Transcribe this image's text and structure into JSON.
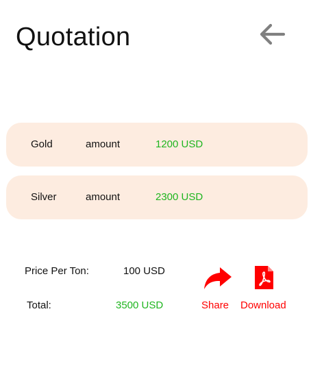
{
  "header": {
    "title": "Quotation",
    "back_icon": "arrow-left-icon"
  },
  "items": [
    {
      "metal": "Gold",
      "amount_label": "amount",
      "value": "1200 USD"
    },
    {
      "metal": "Silver",
      "amount_label": "amount",
      "value": "2300 USD"
    }
  ],
  "summary": {
    "price_label": "Price Per Ton:",
    "price_value": "100 USD",
    "total_label": "Total:",
    "total_value": "3500 USD"
  },
  "actions": {
    "share_label": "Share",
    "share_icon": "share-icon",
    "download_label": "Download",
    "download_icon": "pdf-icon"
  },
  "colors": {
    "card_background": "#fdece0",
    "value_green": "#1fb51f",
    "action_red": "#ff0000",
    "back_arrow_gray": "#808080"
  }
}
